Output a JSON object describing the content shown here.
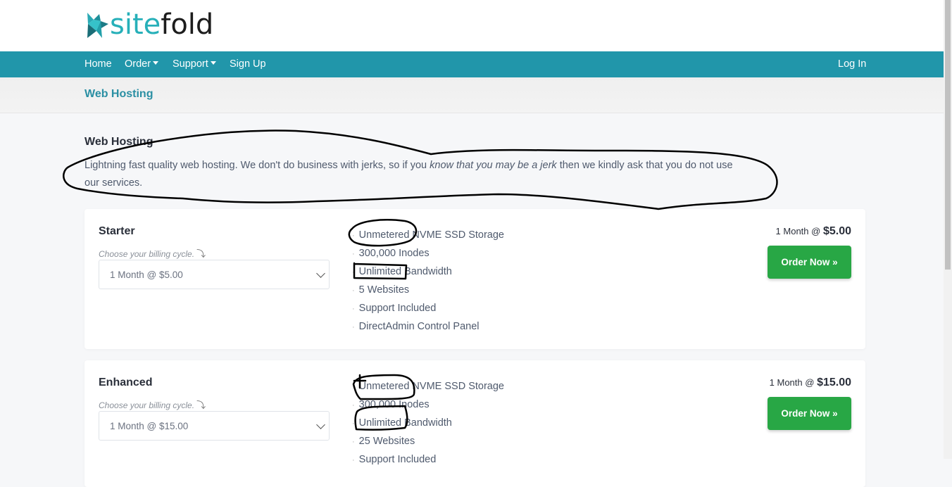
{
  "brand": {
    "name_part1": "site",
    "name_part2": "fold",
    "colors": {
      "teal": "#27b0b9",
      "dark": "#1d1d1d"
    }
  },
  "nav": {
    "left": [
      {
        "label": "Home",
        "dropdown": false
      },
      {
        "label": "Order",
        "dropdown": true
      },
      {
        "label": "Support",
        "dropdown": true
      },
      {
        "label": "Sign Up",
        "dropdown": false
      }
    ],
    "right": {
      "label": "Log In"
    },
    "color": "#2196aa"
  },
  "breadcrumb": {
    "title": "Web Hosting"
  },
  "intro": {
    "title": "Web Hosting",
    "text_before": "Lightning fast quality web hosting. We don't do business with jerks, so if you ",
    "text_emphasis": "know that you may be a jerk",
    "text_after": " then we kindly ask that you do not use our services."
  },
  "plans": [
    {
      "name": "Starter",
      "cycle_label": "Choose your billing cycle.",
      "selected_cycle": "1 Month @ $5.00",
      "features": [
        "Unmetered NVME SSD Storage",
        "300,000 Inodes",
        "Unlimited Bandwidth",
        "5 Websites",
        "Support Included",
        "DirectAdmin Control Panel"
      ],
      "price_period": "1 Month @ ",
      "price": "$5.00",
      "order_label": "Order Now »"
    },
    {
      "name": "Enhanced",
      "cycle_label": "Choose your billing cycle.",
      "selected_cycle": "1 Month @ $15.00",
      "features": [
        "Unmetered NVME SSD Storage",
        "300,000 Inodes",
        "Unlimited Bandwidth",
        "25 Websites",
        "Support Included"
      ],
      "price_period": "1 Month @ ",
      "price": "$15.00",
      "order_label": "Order Now »"
    }
  ],
  "accent_colors": {
    "order_button": "#28a745"
  }
}
